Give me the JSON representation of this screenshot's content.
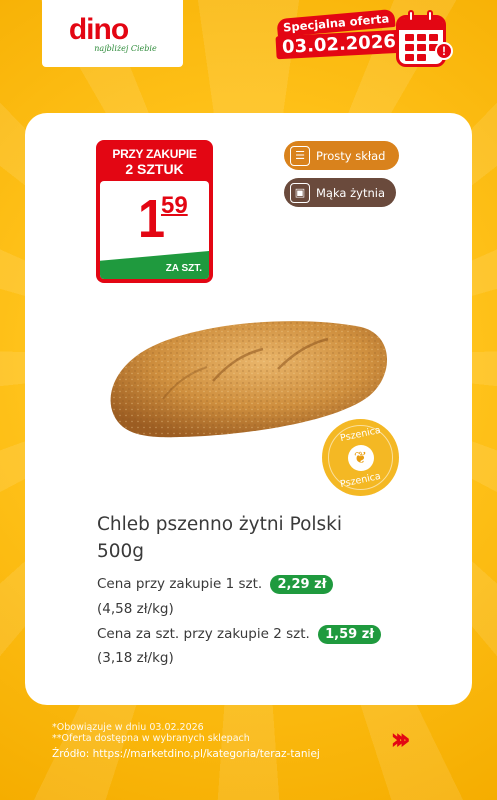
{
  "brand": {
    "name": "dino",
    "tagline": "najbliżej Ciebie",
    "color": "#e30613"
  },
  "offer": {
    "label": "Specjalna oferta",
    "date": "03.02.2026"
  },
  "price_tag": {
    "condition_line1": "PRZY ZAKUPIE",
    "condition_line2": "2 SZTUK",
    "price_int": "1",
    "price_dec": "59",
    "unit": "ZA SZT."
  },
  "badges": [
    {
      "label": "Prosty skład",
      "icon": "ingredients-icon",
      "color": "#d9821c"
    },
    {
      "label": "Mąka żytnia",
      "icon": "flour-icon",
      "color": "#6a4a3c"
    }
  ],
  "wheat_seal": {
    "top": "Pszenica",
    "bottom": "Pszenica"
  },
  "product": {
    "name": "Chleb pszenno żytni Polski",
    "weight": "500g",
    "price1_label": "Cena przy zakupie 1 szt.",
    "price1_value": "2,29 zł",
    "price1_unit": "(4,58 zł/kg)",
    "price2_label": "Cena za szt. przy zakupie 2 szt.",
    "price2_value": "1,59 zł",
    "price2_unit": "(3,18 zł/kg)"
  },
  "footer": {
    "note1": "*Obowiązuje w dniu 03.02.2026",
    "note2": "**Oferta dostępna w wybranych sklepach",
    "source": "Źródło: https://marketdino.pl/kategoria/teraz-taniej"
  }
}
